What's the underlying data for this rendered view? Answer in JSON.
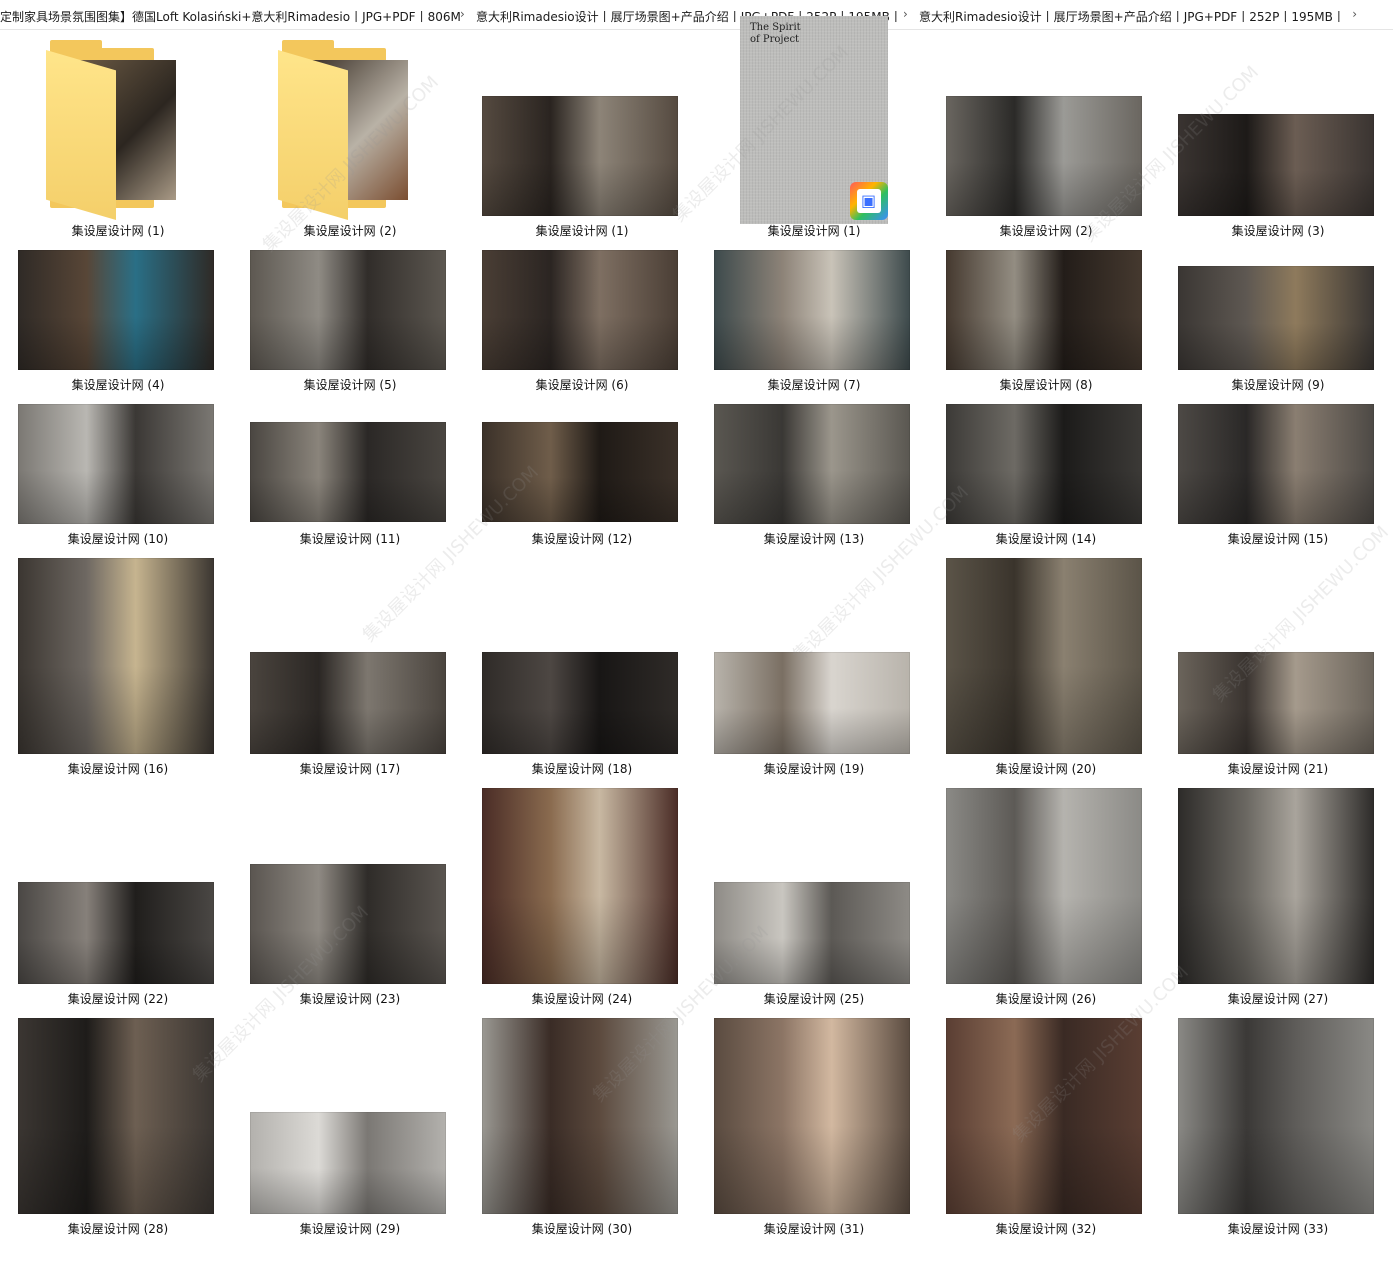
{
  "breadcrumb": {
    "items": [
      "定制家具场景氛围图集】德国Loft Kolasiński+意大利Rimadesio丨JPG+PDF丨806M",
      "意大利Rimadesio设计丨展厅场景图+产品介绍丨JPG+PDF丨252P丨195MB丨",
      "意大利Rimadesio设计丨展厅场景图+产品介绍丨JPG+PDF丨252P丨195MB丨"
    ],
    "separator": "›",
    "more": "›"
  },
  "pdf_cover": {
    "title_line1": "The Spirit",
    "title_line2": "of Project"
  },
  "watermark": "集设屋设计网 JISHEWU.COM",
  "files": [
    {
      "label": "集设屋设计网 (1)",
      "kind": "folder",
      "colors": [
        "#6b5a44",
        "#2c2620",
        "#a99a86"
      ]
    },
    {
      "label": "集设屋设计网 (2)",
      "kind": "folder",
      "colors": [
        "#3a2f26",
        "#b9b2a6",
        "#7b4e31"
      ]
    },
    {
      "label": "集设屋设计网 (1)",
      "kind": "image",
      "colors": [
        "#554a40",
        "#2a2420",
        "#8d8478"
      ]
    },
    {
      "label": "集设屋设计网 (1)",
      "kind": "pdf",
      "colors": [
        "#bdbdbb"
      ]
    },
    {
      "label": "集设屋设计网 (2)",
      "kind": "image",
      "colors": [
        "#6a6660",
        "#2b2a28",
        "#9b9a96"
      ]
    },
    {
      "label": "集设屋设计网 (3)",
      "kind": "image",
      "colors": [
        "#3a3431",
        "#1d1a18",
        "#6b5d53"
      ]
    },
    {
      "label": "集设屋设计网 (4)",
      "kind": "image",
      "colors": [
        "#2f2a26",
        "#584637",
        "#2a6f86"
      ]
    },
    {
      "label": "集设屋设计网 (5)",
      "kind": "image",
      "colors": [
        "#5d5851",
        "#8f8b84",
        "#312d2a"
      ]
    },
    {
      "label": "集设屋设计网 (6)",
      "kind": "image",
      "colors": [
        "#4a3e35",
        "#2b2522",
        "#7e6f62"
      ]
    },
    {
      "label": "集设屋设计网 (7)",
      "kind": "image",
      "colors": [
        "#3d4a4c",
        "#8d8378",
        "#c9c3b8"
      ]
    },
    {
      "label": "集设屋设计网 (8)",
      "kind": "image",
      "colors": [
        "#45392f",
        "#938d82",
        "#231d19"
      ]
    },
    {
      "label": "集设屋设计网 (9)",
      "kind": "image",
      "colors": [
        "#3a3633",
        "#5e5852",
        "#8e7a5c"
      ]
    },
    {
      "label": "集设屋设计网 (10)",
      "kind": "image",
      "colors": [
        "#7b7873",
        "#b9b7b2",
        "#3b3835"
      ]
    },
    {
      "label": "集设屋设计网 (11)",
      "kind": "image",
      "colors": [
        "#4a4641",
        "#8a847b",
        "#2b2826"
      ]
    },
    {
      "label": "集设屋设计网 (12)",
      "kind": "image",
      "colors": [
        "#3b3129",
        "#6f5d4a",
        "#1f1a16"
      ]
    },
    {
      "label": "集设屋设计网 (13)",
      "kind": "image",
      "colors": [
        "#5a5751",
        "#3a3835",
        "#9b968c"
      ]
    },
    {
      "label": "集设屋设计网 (14)",
      "kind": "image",
      "colors": [
        "#3c3a37",
        "#6d6a64",
        "#1c1b1a"
      ]
    },
    {
      "label": "集设屋设计网 (15)",
      "kind": "image",
      "colors": [
        "#4d4945",
        "#2a2827",
        "#8a7e71"
      ]
    },
    {
      "label": "集设屋设计网 (16)",
      "kind": "image",
      "colors": [
        "#3b3631",
        "#6e6862",
        "#c6b48f"
      ]
    },
    {
      "label": "集设屋设计网 (17)",
      "kind": "image",
      "colors": [
        "#4a443e",
        "#2b2724",
        "#7d776f"
      ]
    },
    {
      "label": "集设屋设计网 (18)",
      "kind": "image",
      "colors": [
        "#2f2b28",
        "#4d4743",
        "#181615"
      ]
    },
    {
      "label": "集设屋设计网 (19)",
      "kind": "image",
      "colors": [
        "#b8b3ab",
        "#7a6f63",
        "#d9d5cf"
      ]
    },
    {
      "label": "集设屋设计网 (20)",
      "kind": "image",
      "colors": [
        "#5b5448",
        "#3a342c",
        "#8a8070"
      ]
    },
    {
      "label": "集设屋设计网 (21)",
      "kind": "image",
      "colors": [
        "#6b645b",
        "#3a3430",
        "#a59a8c"
      ]
    },
    {
      "label": "集设屋设计网 (22)",
      "kind": "image",
      "colors": [
        "#4a4744",
        "#86807a",
        "#201e1c"
      ]
    },
    {
      "label": "集设屋设计网 (23)",
      "kind": "image",
      "colors": [
        "#5a5550",
        "#8f8a83",
        "#2f2c29"
      ]
    },
    {
      "label": "集设屋设计网 (24)",
      "kind": "image",
      "colors": [
        "#4a2c26",
        "#8a6b4f",
        "#c8b8a2"
      ]
    },
    {
      "label": "集设屋设计网 (25)",
      "kind": "image",
      "colors": [
        "#8e8b86",
        "#c9c6c0",
        "#5c5955"
      ]
    },
    {
      "label": "集设屋设计网 (26)",
      "kind": "image",
      "colors": [
        "#8b8a86",
        "#5d5a56",
        "#b5b3ae"
      ]
    },
    {
      "label": "集设屋设计网 (27)",
      "kind": "image",
      "colors": [
        "#2d2b29",
        "#6b6862",
        "#a9a49c"
      ]
    },
    {
      "label": "集设屋设计网 (28)",
      "kind": "image",
      "colors": [
        "#3b3632",
        "#1e1c1a",
        "#6d5f52"
      ]
    },
    {
      "label": "集设屋设计网 (29)",
      "kind": "image",
      "colors": [
        "#b3b1ad",
        "#dcdad6",
        "#7b7874"
      ]
    },
    {
      "label": "集设屋设计网 (30)",
      "kind": "image",
      "colors": [
        "#9a9892",
        "#3a2c26",
        "#5c4a3e"
      ]
    },
    {
      "label": "集设屋设计网 (31)",
      "kind": "image",
      "colors": [
        "#5a4b40",
        "#8c7565",
        "#d2b8a0"
      ]
    },
    {
      "label": "集设屋设计网 (32)",
      "kind": "image",
      "colors": [
        "#5a3e33",
        "#8b6a55",
        "#3a2a24"
      ]
    },
    {
      "label": "集设屋设计网 (33)",
      "kind": "image",
      "colors": [
        "#8a8985",
        "#3b3937",
        "#5e5c59"
      ]
    }
  ]
}
